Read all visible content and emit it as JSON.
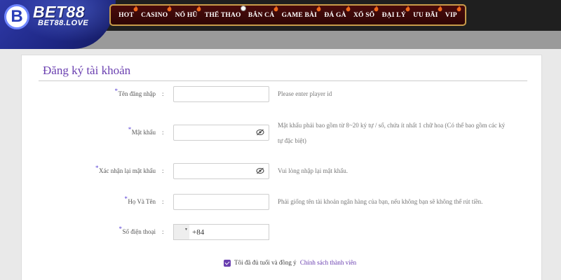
{
  "brand": {
    "badge_letter": "B",
    "name": "BET88",
    "domain": "BET88.LOVE"
  },
  "nav": {
    "items": [
      {
        "label": "HOT",
        "icon": "flame-icon"
      },
      {
        "label": "CASINO",
        "icon": "flame-icon"
      },
      {
        "label": "NỔ HŨ",
        "icon": "flame-icon"
      },
      {
        "label": "THỂ THAO",
        "icon": "soccer-ball-icon"
      },
      {
        "label": "BẮN CÁ",
        "icon": "flame-icon"
      },
      {
        "label": "GAME BÀI",
        "icon": "flame-icon"
      },
      {
        "label": "ĐÁ GÀ",
        "icon": "flame-icon"
      },
      {
        "label": "XỔ SỐ",
        "icon": "flame-icon"
      },
      {
        "label": "ĐẠI LÝ",
        "icon": "flame-icon"
      },
      {
        "label": "ƯU ĐÃI",
        "icon": "flame-icon"
      },
      {
        "label": "VIP",
        "icon": "flame-icon"
      }
    ],
    "accent_color": "#c89c4a",
    "background_color": "#3a0808"
  },
  "form": {
    "title": "Đăng ký tài khoản",
    "required_mark": "*",
    "colon": ":",
    "fields": {
      "username": {
        "label": "Tên đăng nhập",
        "value": "",
        "hint": "Please enter player id"
      },
      "password": {
        "label": "Mật khẩu",
        "value": "",
        "hint_line1": "Mật khẩu phải bao gồm từ 8~20 ký tự / số, chứa ít nhất 1 chữ hoa (Có thể bao gồm các ký",
        "hint_line2": "tự đặc biệt)",
        "toggle_icon": "eye-slash-icon"
      },
      "confirm_password": {
        "label": "Xác nhận lại mật khẩu",
        "value": "",
        "hint": "Vui lòng nhập lại mật khẩu.",
        "toggle_icon": "eye-slash-icon"
      },
      "fullname": {
        "label": "Họ Và Tên",
        "value": "",
        "hint": "Phải giống tên tài khoản ngân hàng của bạn, nếu không bạn sẽ không thể rút tiền."
      },
      "phone": {
        "label": "Số điện thoại",
        "value": "+84"
      }
    },
    "agreement": {
      "checked": true,
      "text": "Tôi đã đủ tuổi và đồng ý",
      "link_text": "Chính sách thành viên"
    },
    "accent_color": "#6a3fb0"
  }
}
